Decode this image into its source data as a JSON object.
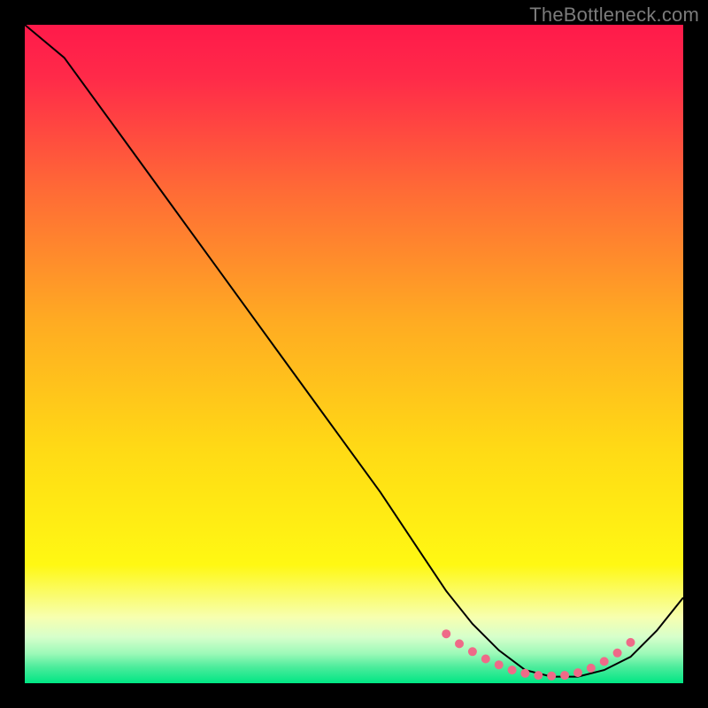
{
  "watermark": "TheBottleneck.com",
  "chart_data": {
    "type": "line",
    "title": "",
    "xlabel": "",
    "ylabel": "",
    "xlim": [
      0,
      100
    ],
    "ylim": [
      0,
      100
    ],
    "grid": false,
    "legend": false,
    "background_gradient": {
      "top_color": "#ff1744",
      "mid_color": "#ffe812",
      "bottom_band_color": "#00e676"
    },
    "curve": {
      "x": [
        0,
        6,
        14,
        22,
        30,
        38,
        46,
        54,
        60,
        64,
        68,
        72,
        76,
        80,
        84,
        88,
        92,
        96,
        100
      ],
      "y": [
        100,
        95,
        84,
        73,
        62,
        51,
        40,
        29,
        20,
        14,
        9,
        5,
        2,
        1,
        1,
        2,
        4,
        8,
        13
      ]
    },
    "markers": {
      "comment": "small pink dots along the trough, read off approximate x positions",
      "x": [
        64,
        66,
        68,
        70,
        72,
        74,
        76,
        78,
        80,
        82,
        84,
        86,
        88,
        90,
        92
      ],
      "y": [
        7.5,
        6.0,
        4.8,
        3.7,
        2.8,
        2.0,
        1.5,
        1.2,
        1.1,
        1.2,
        1.6,
        2.3,
        3.3,
        4.6,
        6.2
      ],
      "color": "#ef6a88",
      "radius": 5
    }
  }
}
